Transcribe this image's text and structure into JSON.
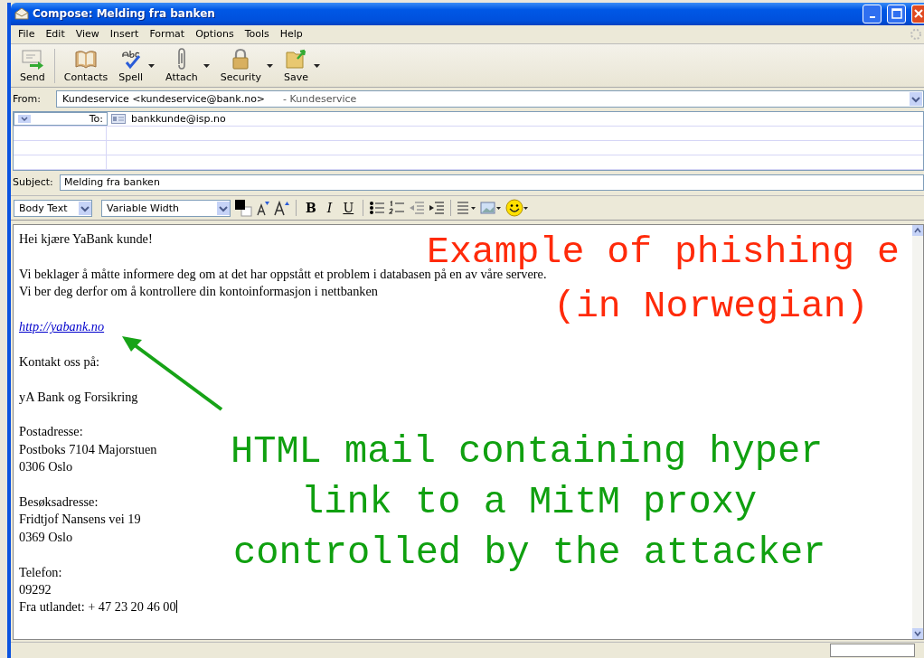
{
  "window": {
    "title": "Compose: Melding fra banken"
  },
  "menu": [
    "File",
    "Edit",
    "View",
    "Insert",
    "Format",
    "Options",
    "Tools",
    "Help"
  ],
  "toolbar": [
    {
      "label": "Send",
      "kind": "send",
      "dropdown": false
    },
    {
      "label": "Contacts",
      "kind": "contacts",
      "dropdown": false
    },
    {
      "label": "Spell",
      "kind": "spell",
      "dropdown": true
    },
    {
      "label": "Attach",
      "kind": "attach",
      "dropdown": true
    },
    {
      "label": "Security",
      "kind": "security",
      "dropdown": true
    },
    {
      "label": "Save",
      "kind": "save",
      "dropdown": true
    }
  ],
  "from": {
    "label": "From:",
    "value": "Kundeservice <kundeservice@bank.no>",
    "account": "- Kundeservice"
  },
  "recipients": {
    "type": "To:",
    "address": "bankkunde@isp.no"
  },
  "subject": {
    "label": "Subject:",
    "value": "Melding fra banken"
  },
  "format": {
    "paragraph_style": "Body Text",
    "font": "Variable Width",
    "bold": "B",
    "italic": "I",
    "underline": "U"
  },
  "body": [
    {
      "kind": "text",
      "lines": [
        "Hei kjære YaBank kunde!"
      ]
    },
    {
      "kind": "text",
      "lines": [
        "Vi beklager å måtte informere deg om at det har oppstått et problem i databasen på en av våre servere.",
        "Vi ber deg derfor om å kontrollere din kontoinformasjon i nettbanken"
      ]
    },
    {
      "kind": "link",
      "lines": [
        "http://yabank.no"
      ]
    },
    {
      "kind": "text",
      "lines": [
        "Kontakt oss på:"
      ]
    },
    {
      "kind": "text",
      "lines": [
        "yA Bank og Forsikring"
      ]
    },
    {
      "kind": "text",
      "lines": [
        "Postadresse:",
        "Postboks 7104 Majorstuen",
        "0306 Oslo"
      ]
    },
    {
      "kind": "text",
      "lines": [
        "Besøksadresse:",
        "Fridtjof Nansens vei 19",
        "0369 Oslo"
      ]
    },
    {
      "kind": "text",
      "lines": [
        "Telefon:",
        "09292",
        "Fra utlandet: + 47 23 20 46 00"
      ]
    }
  ],
  "annotations": [
    {
      "kind": "title",
      "lines": [
        "Example of phishing e",
        "(in Norwegian)"
      ]
    },
    {
      "kind": "callout",
      "lines": [
        "HTML mail containing hyper",
        "link to a MitM proxy",
        "controlled by the attacker"
      ]
    }
  ]
}
